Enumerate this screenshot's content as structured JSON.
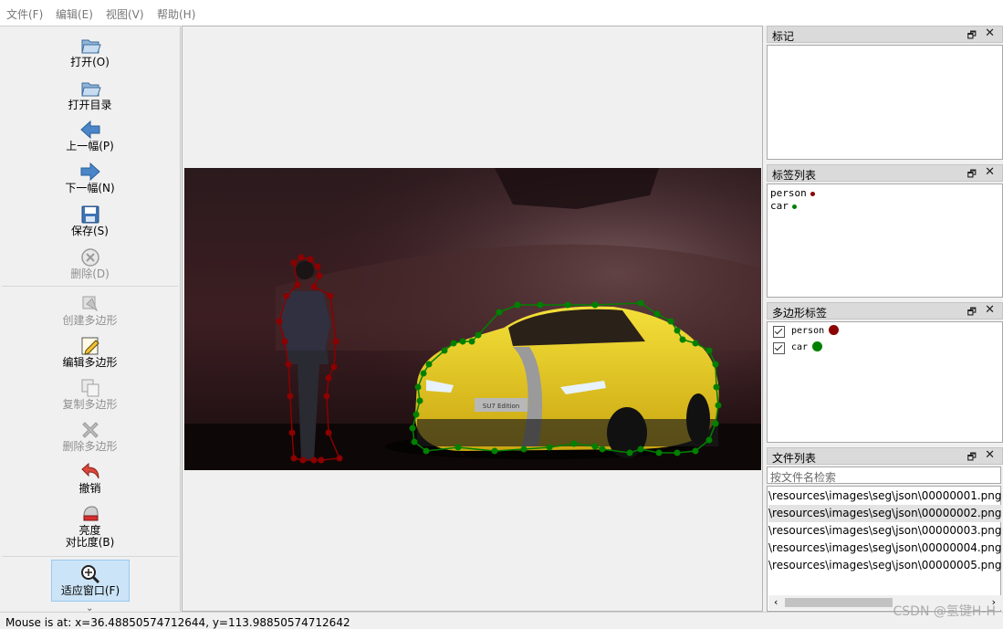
{
  "menu": [
    "文件(F)",
    "编辑(E)",
    "视图(V)",
    "帮助(H)"
  ],
  "toolbar": {
    "open": "打开(O)",
    "open_dir": "打开目录",
    "prev": "上一幅(P)",
    "next": "下一幅(N)",
    "save": "保存(S)",
    "delete": "删除(D)",
    "create_polygon": "创建多边形",
    "edit_polygon": "编辑多边形",
    "copy_polygon": "复制多边形",
    "delete_polygon": "删除多边形",
    "undo": "撤销",
    "brightness_1": "亮度",
    "brightness_2": "对比度(B)",
    "fit_window": "适应窗口(F)",
    "more": "»"
  },
  "docks": {
    "flags": {
      "title": "标记"
    },
    "labels": {
      "title": "标签列表",
      "items": [
        {
          "name": "person",
          "color": "#8b0000"
        },
        {
          "name": "car",
          "color": "#008000"
        }
      ]
    },
    "polygons": {
      "title": "多边形标签",
      "items": [
        {
          "name": "person",
          "color": "#8b0000"
        },
        {
          "name": "car",
          "color": "#008000"
        }
      ]
    },
    "files": {
      "title": "文件列表",
      "search_placeholder": "按文件名检索",
      "items": [
        "\\resources\\images\\seg\\json\\00000001.png",
        "\\resources\\images\\seg\\json\\00000002.png",
        "\\resources\\images\\seg\\json\\00000003.png",
        "\\resources\\images\\seg\\json\\00000004.png",
        "\\resources\\images\\seg\\json\\00000005.png"
      ],
      "selected_index": 1
    },
    "float_glyph": "🗗",
    "close_glyph": "✕"
  },
  "image": {
    "plate_text": "SU7 Edition"
  },
  "status": "Mouse is at: x=36.48850574712644, y=113.98850574712642",
  "watermark": "CSDN @氢键H-H"
}
